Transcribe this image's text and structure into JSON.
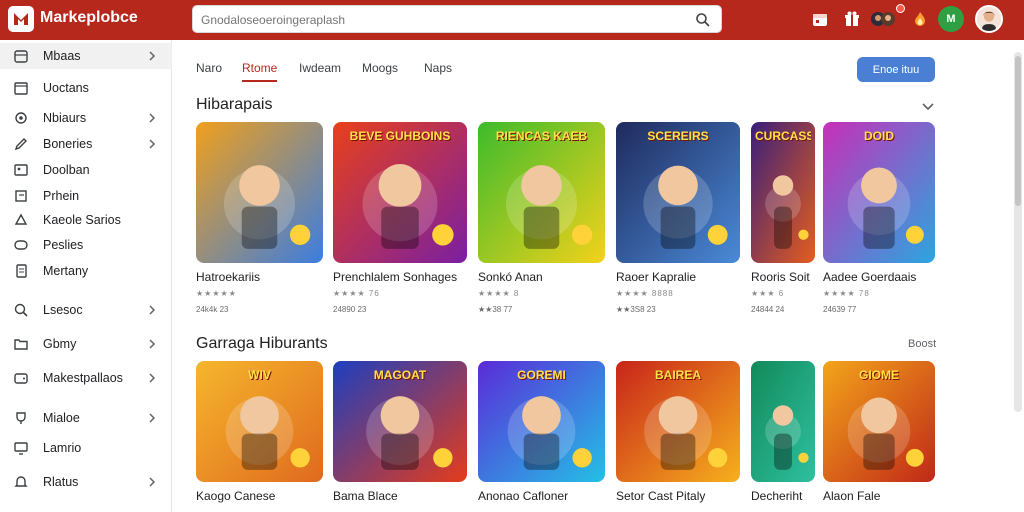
{
  "header": {
    "brand": "Markeplobce",
    "search_placeholder": "Gnodaloseoeroingeraplash"
  },
  "sidebar": {
    "items": [
      {
        "label": "Mbaas",
        "icon": "box-icon",
        "chevron": true
      },
      {
        "label": "Uoctans",
        "icon": "calendar-icon",
        "chevron": false
      },
      {
        "label": "Nbiaurs",
        "icon": "gear-icon",
        "chevron": true
      },
      {
        "label": "Boneries",
        "icon": "pencil-icon",
        "chevron": true
      },
      {
        "label": "Doolban",
        "icon": "image-icon",
        "chevron": false
      },
      {
        "label": "Prhein",
        "icon": "flag-icon",
        "chevron": false
      },
      {
        "label": "Kaeole Sarios",
        "icon": "triangle-icon",
        "chevron": false
      },
      {
        "label": "Peslies",
        "icon": "tag-icon",
        "chevron": false
      },
      {
        "label": "Mertany",
        "icon": "document-icon",
        "chevron": false
      },
      {
        "label": "Lsesoc",
        "icon": "search-icon",
        "chevron": true
      },
      {
        "label": "Gbmy",
        "icon": "folder-icon",
        "chevron": true
      },
      {
        "label": "Makestpallaos",
        "icon": "wallet-icon",
        "chevron": true
      },
      {
        "label": "Mialoe",
        "icon": "trophy-icon",
        "chevron": true
      },
      {
        "label": "Lamrio",
        "icon": "monitor-icon",
        "chevron": false
      },
      {
        "label": "Rlatus",
        "icon": "bell-icon",
        "chevron": true
      }
    ]
  },
  "tabs": [
    "Naro",
    "Rtome",
    "Iwdeam",
    "Moogs",
    "Naps"
  ],
  "cta_label": "Enoe ituu",
  "sections": [
    {
      "title": "Hibarapais",
      "cards": [
        {
          "title": "Hatroekariis",
          "rating": "★★★★★",
          "meta": "24k4k 23"
        },
        {
          "title": "Prenchlalem Sonhages",
          "rating": "★★★★ 76",
          "meta": "24890 23"
        },
        {
          "title": "Sonkó Anan",
          "rating": "★★★★ 8",
          "meta": "★★38 77"
        },
        {
          "title": "Raoer Kapralie",
          "rating": "★★★★ 8888",
          "meta": "★★3S8 23"
        },
        {
          "title": "Rooris Soit",
          "rating": "★★★ 6",
          "meta": "24844 24"
        },
        {
          "title": "Aadee Goerdaais",
          "rating": "★★★★ 78",
          "meta": "24639 77"
        }
      ]
    },
    {
      "title": "Garraga Hiburants",
      "more": "Boost",
      "cards": [
        {
          "title": "Kaogo Canese"
        },
        {
          "title": "Bama Blace"
        },
        {
          "title": "Anonao Cafloner"
        },
        {
          "title": "Setor Cast Pitaly"
        },
        {
          "title": "Decheriht"
        },
        {
          "title": "Alaon Fale"
        }
      ]
    }
  ],
  "thumbs": {
    "row1": [
      {
        "bg1": "#f0a01c",
        "bg2": "#3b7de0",
        "text": ""
      },
      {
        "bg1": "#e8401a",
        "bg2": "#7a1fa2",
        "text": "BEVE GUHBOINS"
      },
      {
        "bg1": "#3dbb2c",
        "bg2": "#f3d21b",
        "text": "RIENCAS KAEB"
      },
      {
        "bg1": "#1f2a5c",
        "bg2": "#4a8ad8",
        "text": "SCEREIRS"
      },
      {
        "bg1": "#3a1f7a",
        "bg2": "#e55d1e",
        "text": "CURCASS"
      },
      {
        "bg1": "#c72fb8",
        "bg2": "#2aa6e0",
        "text": "DOID"
      }
    ],
    "row2": [
      {
        "bg1": "#f5b62c",
        "bg2": "#e06a1e",
        "text": "WIV"
      },
      {
        "bg1": "#1d3fbf",
        "bg2": "#e53b1b",
        "text": "MAGOAT"
      },
      {
        "bg1": "#5a2bd8",
        "bg2": "#24c0e6",
        "text": "GOREMI"
      },
      {
        "bg1": "#c8241a",
        "bg2": "#f6b11c",
        "text": "BAIREA"
      },
      {
        "bg1": "#128a5a",
        "bg2": "#2ec0a0",
        "text": ""
      },
      {
        "bg1": "#f3a51a",
        "bg2": "#c02818",
        "text": "GIOME"
      }
    ]
  }
}
